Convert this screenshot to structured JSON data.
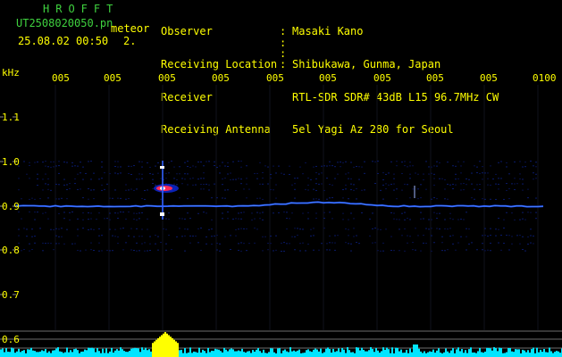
{
  "header": {
    "title": "HROFFT",
    "filename": "UT2508020050.pn",
    "tag": "meteor",
    "datetime": "25.08.02 00:50",
    "count": "2.",
    "info_rows": [
      {
        "label": "Observer",
        "value": "Masaki Kano"
      },
      {
        "label": "Receiving Location",
        "value": "Shibukawa, Gunma, Japan"
      },
      {
        "label": "Receiver",
        "value": "RTL-SDR SDR# 43dB L15 96.7MHz CW"
      },
      {
        "label": "Receiving Antenna",
        "value": "5el Yagi Az 280 for Seoul"
      }
    ]
  },
  "axis": {
    "unit": "kHz",
    "time_ticks": [
      "005",
      "005",
      "005",
      "005",
      "005",
      "005",
      "005",
      "005",
      "005",
      "0100"
    ],
    "freq_ticks": [
      "1.1",
      "1.0",
      "0.9",
      "0.8",
      "0.7",
      "0.6"
    ]
  },
  "colors": {
    "background": "#000000",
    "text": "#ffff00",
    "title": "#3fd13f",
    "grid": "#2a2a40",
    "trace": "#2050ff",
    "meteor": "#ff2a55",
    "amplitude": "#00e5ff",
    "amplitude_peak": "#ffff00"
  }
}
